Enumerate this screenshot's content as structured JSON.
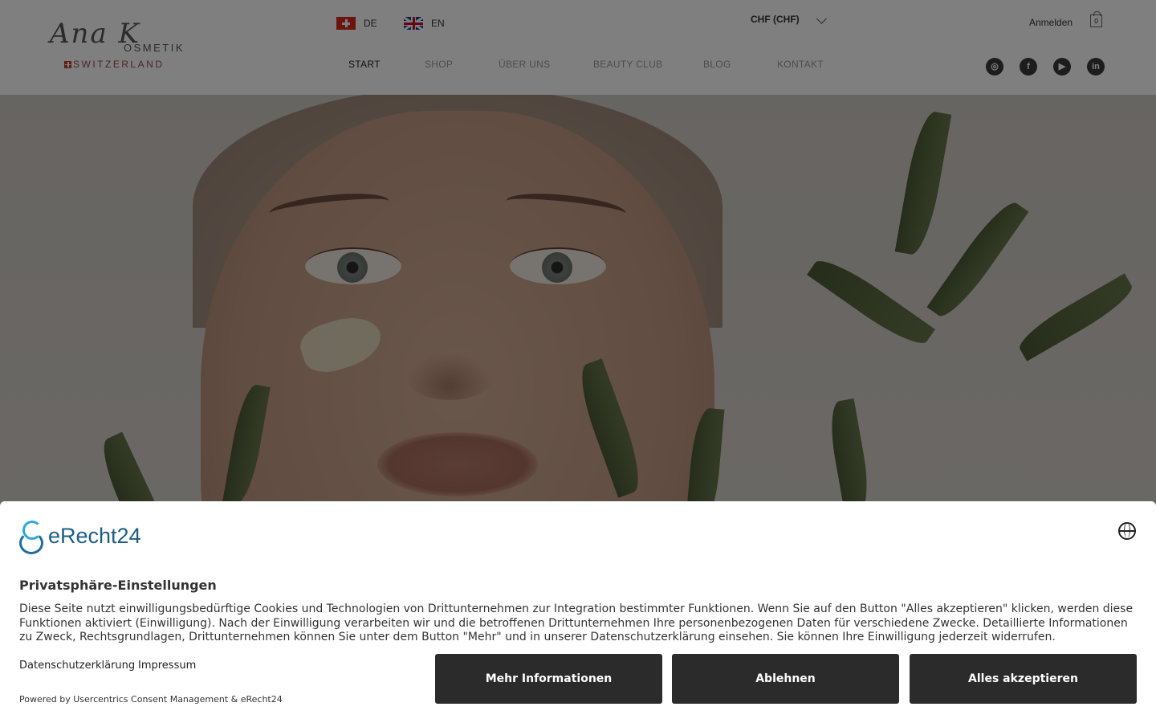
{
  "header": {
    "logo": {
      "script": "Ana K",
      "word": "OSMETIK",
      "sub": "SWITZERLAND"
    },
    "languages": [
      {
        "code": "DE",
        "flag": "flag-switzerland"
      },
      {
        "code": "EN",
        "flag": "flag-uk"
      }
    ],
    "currency": "CHF (CHF)",
    "signin": "Anmelden",
    "cart_count": "0",
    "nav": [
      "START",
      "SHOP",
      "ÜBER UNS",
      "BEAUTY CLUB",
      "BLOG",
      "KONTAKT"
    ],
    "social": [
      {
        "name": "instagram-icon",
        "glyph": "◎"
      },
      {
        "name": "facebook-icon",
        "glyph": "f"
      },
      {
        "name": "youtube-icon",
        "glyph": "▶"
      },
      {
        "name": "linkedin-icon",
        "glyph": "in"
      }
    ]
  },
  "consent": {
    "brand": "eRecht24",
    "title": "Privatsphäre-Einstellungen",
    "text": "Diese Seite nutzt einwilligungsbedürftige Cookies und Technologien von Drittunternehmen zur Integration bestimmter Funktionen. Wenn Sie auf den Button \"Alles akzeptieren\" klicken, werden diese Funktionen aktiviert (Einwilligung). Nach der Einwilligung verarbeiten wir und die betroffenen Drittunternehmen Ihre personenbezogenen Daten für verschiedene Zwecke. Detaillierte Informationen zu Zweck, Rechtsgrundlagen, Drittunternehmen können Sie unter dem Button \"Mehr\" und in unserer Datenschutzerklärung einsehen. Sie können Ihre Einwilligung jederzeit widerrufen.",
    "links": [
      "Datenschutzerklärung",
      "Impressum"
    ],
    "powered": "Powered by Usercentrics Consent Management & eRecht24",
    "buttons": {
      "more": "Mehr Informationen",
      "decline": "Ablehnen",
      "accept": "Alles akzeptieren"
    }
  }
}
